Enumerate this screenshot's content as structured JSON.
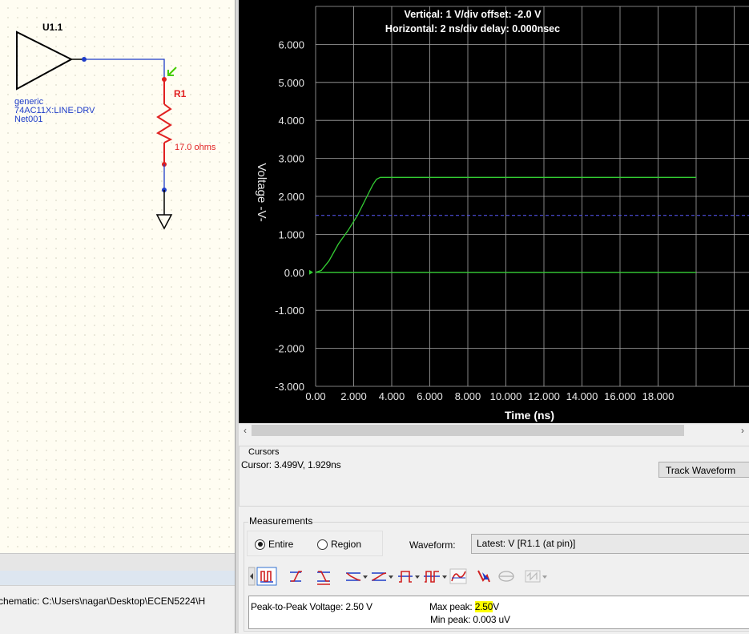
{
  "schematic": {
    "buffer_ref": "U1.1",
    "buffer_lines": [
      "generic",
      "74AC11X:LINE-DRV",
      "Net001"
    ],
    "resistor_ref": "R1",
    "resistor_value": "17.0 ohms"
  },
  "status_bar": {
    "path": "chematic: C:\\Users\\nagar\\Desktop\\ECEN5224\\H"
  },
  "scope": {
    "header_vertical": "Vertical: 1  V/div  offset: -2.0 V",
    "header_horizontal": "Horizontal: 2  ns/div  delay: 0.000nsec",
    "y_axis_label": "Voltage  -V-",
    "x_axis_label": "Time  (ns)",
    "colors": {
      "background": "#000000",
      "grid": "#a8a8a8",
      "trace": "#33cc33",
      "reference": "#5a5aff",
      "zero_line": "#33cc33"
    }
  },
  "chart_data": {
    "type": "line",
    "xlabel": "Time  (ns)",
    "ylabel": "Voltage  -V-",
    "xlim": [
      0,
      20
    ],
    "ylim": [
      -3,
      7
    ],
    "x_ticks": [
      "0.00",
      "2.000",
      "4.000",
      "6.000",
      "8.000",
      "10.000",
      "12.000",
      "14.000",
      "16.000",
      "18.000"
    ],
    "y_ticks": [
      "6.000",
      "5.000",
      "4.000",
      "3.000",
      "2.000",
      "1.000",
      "0.00",
      "-1.000",
      "-2.000",
      "-3.000"
    ],
    "grid": true,
    "series": [
      {
        "x": [
          0,
          0.3,
          0.7,
          1.2,
          1.7,
          2.2,
          2.7,
          3.0,
          3.2,
          3.4,
          20
        ],
        "y": [
          0.0,
          0.05,
          0.3,
          0.75,
          1.1,
          1.5,
          2.0,
          2.3,
          2.45,
          2.5,
          2.5
        ]
      },
      {
        "x": [
          0,
          20
        ],
        "y": [
          0,
          0
        ]
      }
    ],
    "reference_line": {
      "y": 1.5
    }
  },
  "cursors": {
    "title": "Cursors",
    "readout": "Cursor: 3.499V, 1.929ns",
    "track_button": "Track Waveform"
  },
  "measurements": {
    "title": "Measurements",
    "range_options": [
      "Entire",
      "Region"
    ],
    "range_selected": "Entire",
    "waveform_label": "Waveform:",
    "waveform_value": "Latest: V [R1.1 (at pin)]",
    "toolbar_icons": [
      "scroll-left-icon",
      "pulse-measure-icon",
      "rise-edge-icon",
      "fall-edge-icon",
      "overshoot-icon",
      "undershoot-icon",
      "width-icon",
      "period-icon",
      "curve-icon",
      "cursor-pick-icon",
      "eye-icon",
      "delay-icon"
    ],
    "peak_to_peak_label": "Peak-to-Peak Voltage: 2.50 V",
    "max_peak_label": "Max peak:",
    "max_peak_value": "2.50",
    "max_peak_unit": "V",
    "min_peak_label": "Min peak: 0.003 uV"
  }
}
